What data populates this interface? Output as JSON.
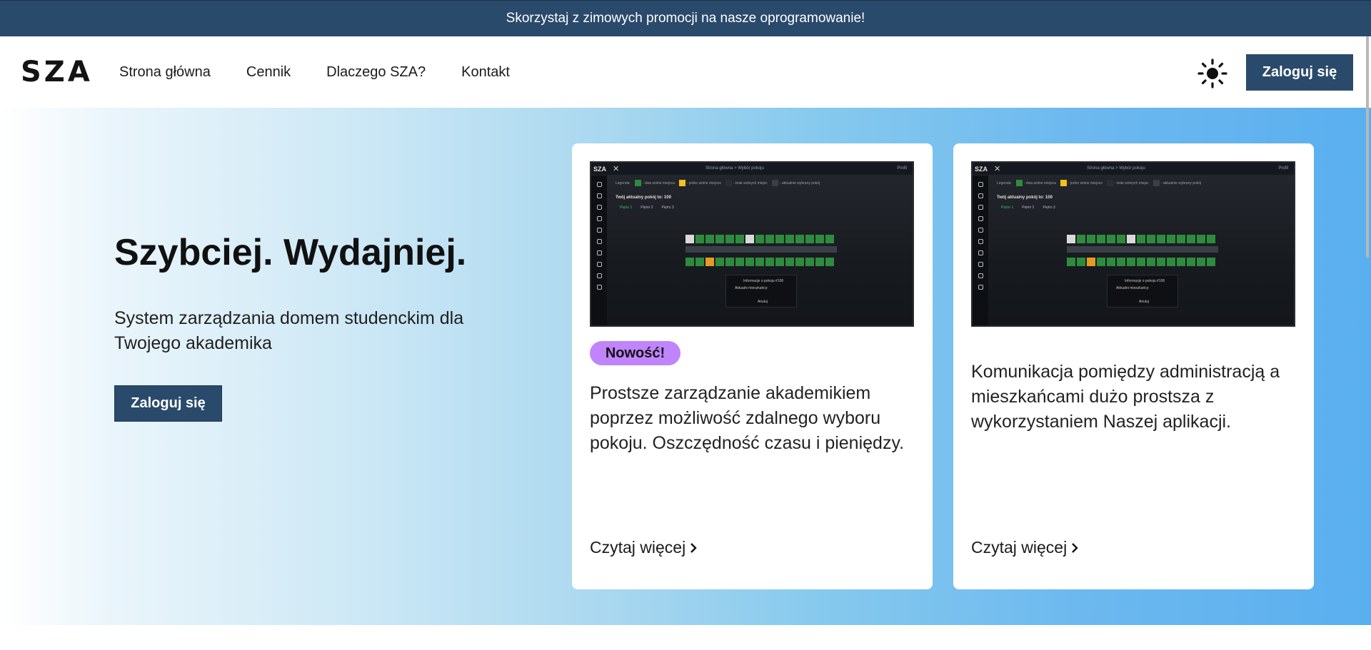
{
  "promo": {
    "text": "Skorzystaj z zimowych promocji na nasze oprogramowanie!"
  },
  "nav": {
    "logo": "SZA",
    "items": [
      {
        "label": "Strona główna"
      },
      {
        "label": "Cennik"
      },
      {
        "label": "Dlaczego SZA?"
      },
      {
        "label": "Kontakt"
      }
    ],
    "theme_icon": "sun-icon",
    "login_label": "Zaloguj się"
  },
  "hero": {
    "title": "Szybciej. Wydajniej.",
    "subtitle": "System zarządzania domem studenckim dla Twojego akademika",
    "login_label": "Zaloguj się"
  },
  "cards": [
    {
      "badge": "Nowość!",
      "text": "Prostsze zarządzanie akademikiem poprzez możliwość zdalnego wyboru pokoju. Oszczędność czasu i pieniędzy.",
      "read_more": "Czytaj więcej"
    },
    {
      "text": "Komunikacja pomiędzy administracją a mieszkańcami dużo prostsza z wykorzystaniem Naszej aplikacji.",
      "read_more": "Czytaj więcej"
    }
  ],
  "app_preview": {
    "logo": "SZA",
    "breadcrumb": "Strona główna > Wybór pokoju",
    "profile": "Profil",
    "legend": [
      "- dwa wolne miejsca",
      "- jedno wolne miejsce",
      "- brak wolnych miejsc",
      "- aktualnie wybrany pokój"
    ],
    "legend_label": "Legenda:",
    "room_title": "Twój aktualny pokój to: 100",
    "floors": [
      "Piętro 1",
      "Piętro 2",
      "Piętro 3"
    ],
    "info_title": "Informacje o pokoju #106",
    "info_residents": "Aktualni mieszkańcy:",
    "info_cancel": "Anuluj"
  },
  "colors": {
    "brand": "#2a4a6b",
    "badge": "#c084fc",
    "free": "#2e8b3e",
    "selected": "#e89b22"
  }
}
